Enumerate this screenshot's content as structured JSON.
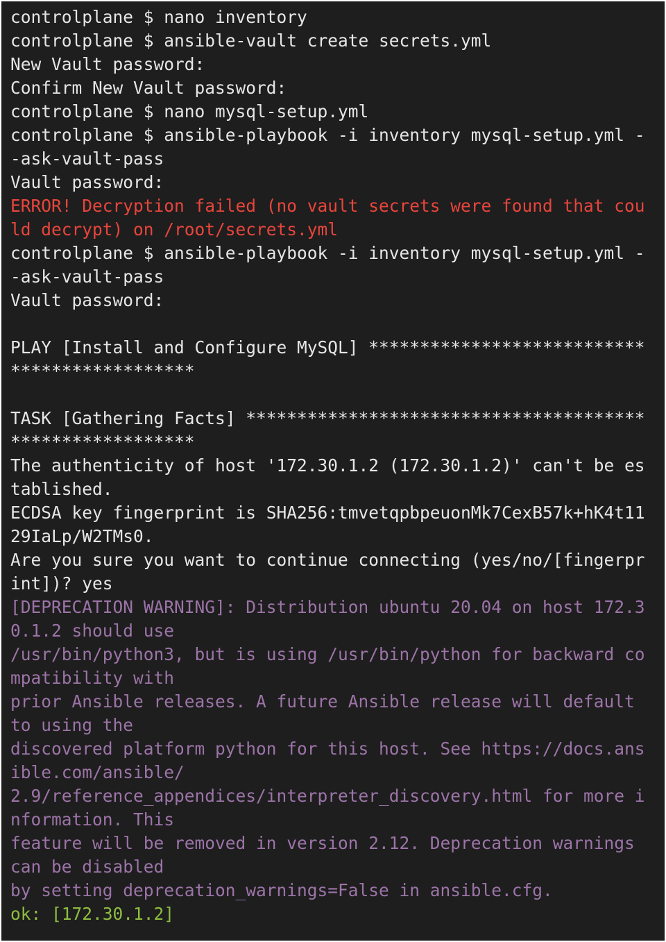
{
  "colors": {
    "background": "#1e1e1e",
    "text": "#e6e6e6",
    "error": "#e8453c",
    "warning": "#9c74a8",
    "ok": "#8ebd3f"
  },
  "lines": [
    {
      "text": "controlplane $ nano inventory",
      "type": "normal"
    },
    {
      "text": "controlplane $ ansible-vault create secrets.yml",
      "type": "normal"
    },
    {
      "text": "New Vault password:",
      "type": "normal"
    },
    {
      "text": "Confirm New Vault password:",
      "type": "normal"
    },
    {
      "text": "controlplane $ nano mysql-setup.yml",
      "type": "normal"
    },
    {
      "text": "controlplane $ ansible-playbook -i inventory mysql-setup.yml -",
      "type": "normal"
    },
    {
      "text": "-ask-vault-pass",
      "type": "normal"
    },
    {
      "text": "Vault password:",
      "type": "normal"
    },
    {
      "text": "ERROR! Decryption failed (no vault secrets were found that cou",
      "type": "error"
    },
    {
      "text": "ld decrypt) on /root/secrets.yml",
      "type": "error"
    },
    {
      "text": "controlplane $ ansible-playbook -i inventory mysql-setup.yml -",
      "type": "normal"
    },
    {
      "text": "-ask-vault-pass",
      "type": "normal"
    },
    {
      "text": "Vault password:",
      "type": "normal"
    },
    {
      "text": "",
      "type": "normal"
    },
    {
      "text": "PLAY [Install and Configure MySQL] ***************************",
      "type": "normal"
    },
    {
      "text": "******************",
      "type": "normal"
    },
    {
      "text": "",
      "type": "normal"
    },
    {
      "text": "TASK [Gathering Facts] ***************************************",
      "type": "normal"
    },
    {
      "text": "******************",
      "type": "normal"
    },
    {
      "text": "The authenticity of host '172.30.1.2 (172.30.1.2)' can't be es",
      "type": "normal"
    },
    {
      "text": "tablished.",
      "type": "normal"
    },
    {
      "text": "ECDSA key fingerprint is SHA256:tmvetqpbpeuonMk7CexB57k+hK4t11",
      "type": "normal"
    },
    {
      "text": "29IaLp/W2TMs0.",
      "type": "normal"
    },
    {
      "text": "Are you sure you want to continue connecting (yes/no/[fingerpr",
      "type": "normal"
    },
    {
      "text": "int])? yes",
      "type": "normal"
    },
    {
      "text": "[DEPRECATION WARNING]: Distribution ubuntu 20.04 on host 172.3",
      "type": "warning"
    },
    {
      "text": "0.1.2 should use",
      "type": "warning"
    },
    {
      "text": "/usr/bin/python3, but is using /usr/bin/python for backward co",
      "type": "warning"
    },
    {
      "text": "mpatibility with",
      "type": "warning"
    },
    {
      "text": "prior Ansible releases. A future Ansible release will default",
      "type": "warning"
    },
    {
      "text": "to using the",
      "type": "warning"
    },
    {
      "text": "discovered platform python for this host. See https://docs.ans",
      "type": "warning"
    },
    {
      "text": "ible.com/ansible/",
      "type": "warning"
    },
    {
      "text": "2.9/reference_appendices/interpreter_discovery.html for more i",
      "type": "warning"
    },
    {
      "text": "nformation. This",
      "type": "warning"
    },
    {
      "text": "feature will be removed in version 2.12. Deprecation warnings",
      "type": "warning"
    },
    {
      "text": "can be disabled",
      "type": "warning"
    },
    {
      "text": "by setting deprecation_warnings=False in ansible.cfg.",
      "type": "warning"
    },
    {
      "text": "ok: [172.30.1.2]",
      "type": "ok"
    }
  ]
}
